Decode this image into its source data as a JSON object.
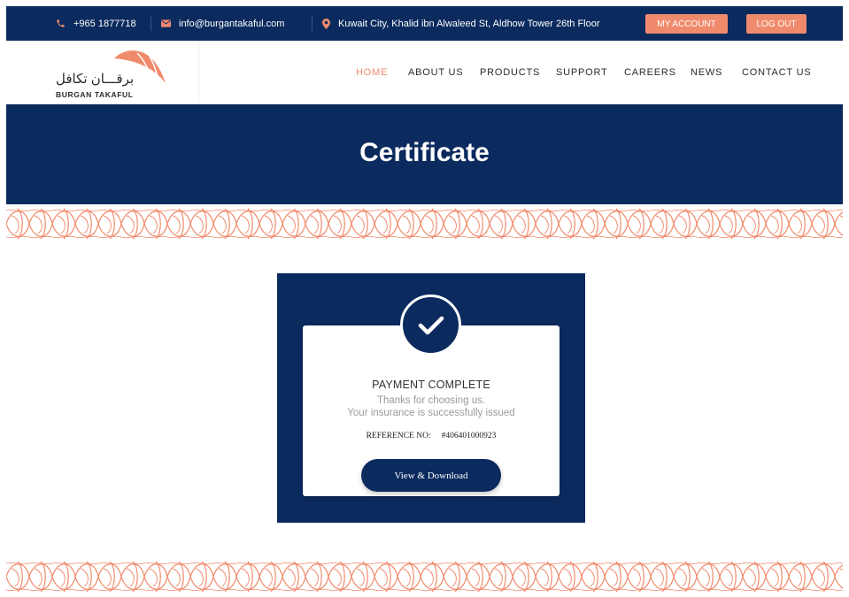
{
  "topbar": {
    "phone": "+965 1877718",
    "email": "info@burgantakaful.com",
    "address": "Kuwait City, Khalid ibn Alwaleed St, Aldhow Tower 26th Floor",
    "my_account_label": "MY ACCOUNT",
    "logout_label": "LOG OUT"
  },
  "logo": {
    "arabic": "برقـــان تكافل",
    "english": "BURGAN TAKAFUL"
  },
  "nav": {
    "items": [
      {
        "label": "HOME",
        "active": true
      },
      {
        "label": "ABOUT US"
      },
      {
        "label": "PRODUCTS"
      },
      {
        "label": "SUPPORT"
      },
      {
        "label": "CAREERS"
      },
      {
        "label": "NEWS"
      },
      {
        "label": "CONTACT US"
      }
    ]
  },
  "hero": {
    "title": "Certificate"
  },
  "certificate": {
    "title": "PAYMENT COMPLETE",
    "line1": "Thanks for choosing us.",
    "line2": "Your insurance is successfully issued",
    "reference_label": "REFERENCE NO:",
    "reference_value": "#406401000923",
    "button_label": "View & Download"
  },
  "colors": {
    "navy": "#0b2a5e",
    "accent": "#f08a6c"
  },
  "icons": {
    "phone": "phone-icon",
    "email": "envelope-icon",
    "location": "map-pin-icon",
    "check": "check-icon"
  }
}
